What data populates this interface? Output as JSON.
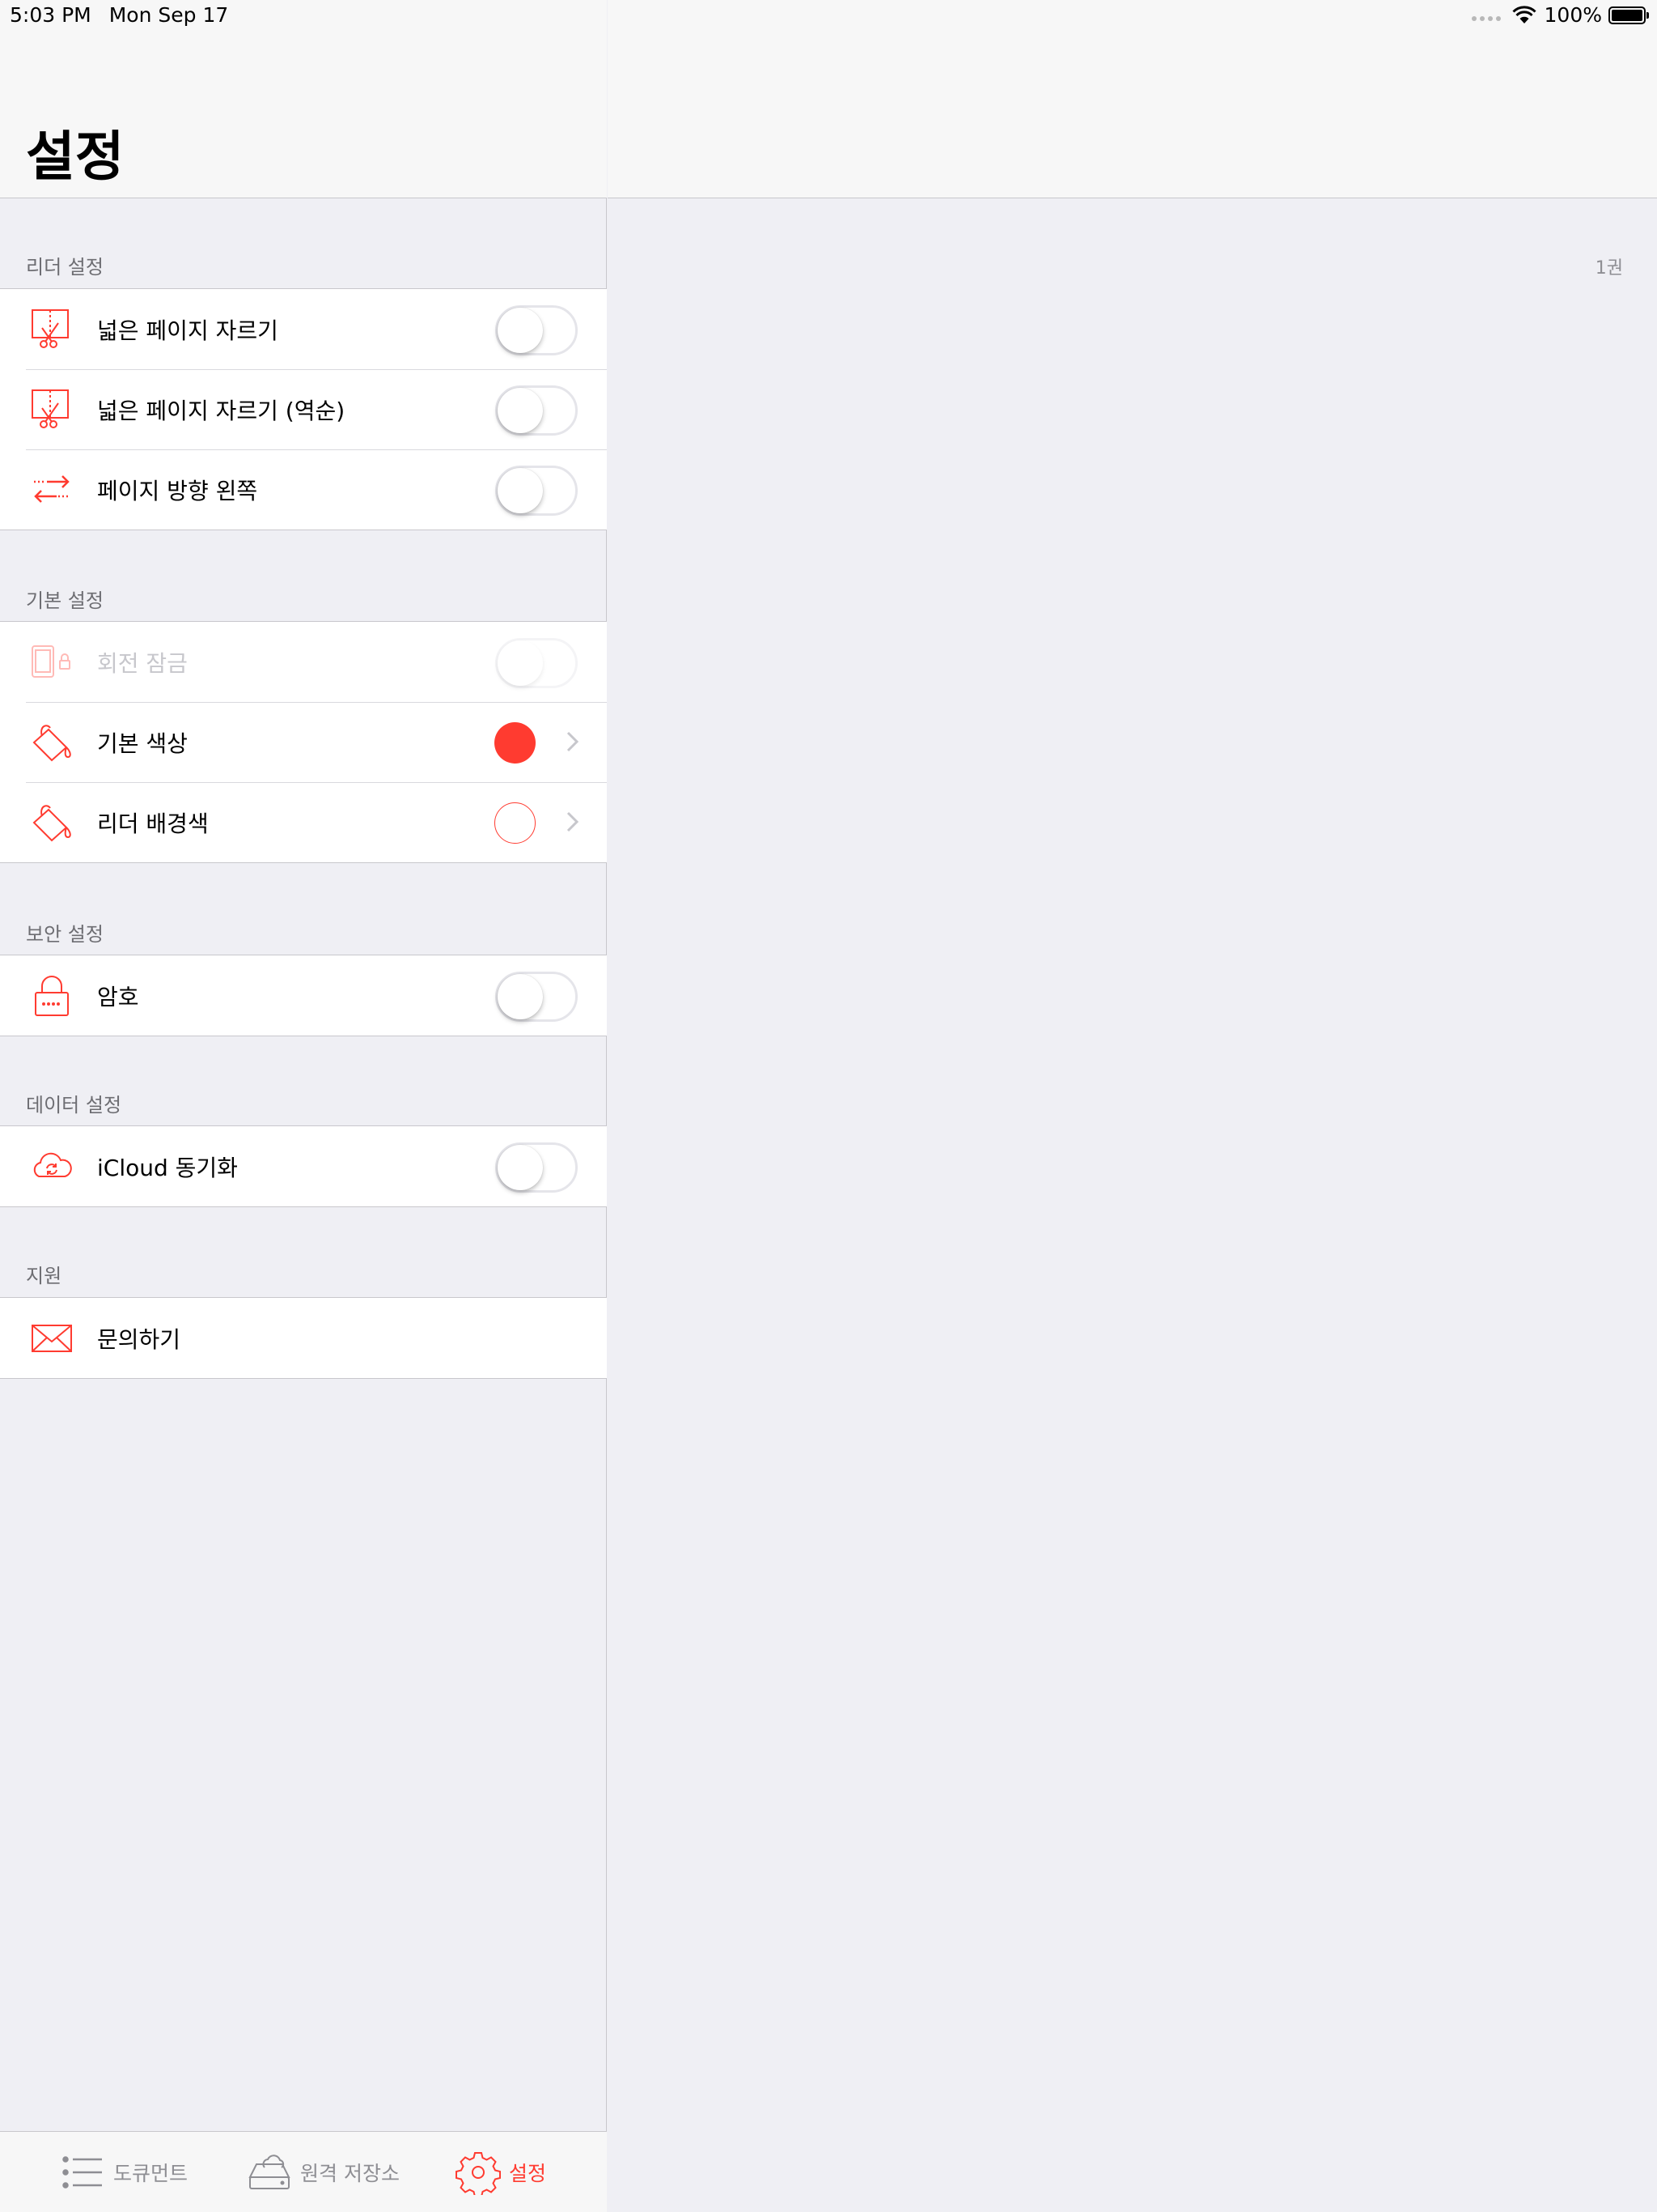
{
  "status_bar": {
    "time": "5:03 PM",
    "date": "Mon Sep 17",
    "battery": "100%"
  },
  "title": "설정",
  "right_pane": {
    "count": "1권"
  },
  "colors": {
    "accent": "#ff3b30"
  },
  "sections": [
    {
      "header": "리더 설정",
      "rows": [
        {
          "label": "넓은 페이지 자르기",
          "icon": "crop-scissors-icon",
          "control": "toggle"
        },
        {
          "label": "넓은 페이지 자르기 (역순)",
          "icon": "crop-scissors-icon",
          "control": "toggle"
        },
        {
          "label": "페이지 방향 왼쪽",
          "icon": "swap-arrows-icon",
          "control": "toggle"
        }
      ]
    },
    {
      "header": "기본 설정",
      "rows": [
        {
          "label": "회전 잠금",
          "icon": "rotation-lock-icon",
          "control": "toggle",
          "disabled": true
        },
        {
          "label": "기본 색상",
          "icon": "paint-bucket-icon",
          "control": "color",
          "color": "#ff3b30"
        },
        {
          "label": "리더 배경색",
          "icon": "paint-bucket-icon",
          "control": "color",
          "color": "#ffffff"
        }
      ]
    },
    {
      "header": "보안 설정",
      "rows": [
        {
          "label": "암호",
          "icon": "lock-icon",
          "control": "toggle"
        }
      ]
    },
    {
      "header": "데이터 설정",
      "rows": [
        {
          "label": "iCloud 동기화",
          "icon": "cloud-sync-icon",
          "control": "toggle"
        }
      ]
    },
    {
      "header": "지원",
      "rows": [
        {
          "label": "문의하기",
          "icon": "mail-icon",
          "control": "none"
        }
      ]
    }
  ],
  "tabs": [
    {
      "label": "도큐먼트",
      "icon": "list-icon",
      "active": false
    },
    {
      "label": "원격 저장소",
      "icon": "cloud-drive-icon",
      "active": false
    },
    {
      "label": "설정",
      "icon": "gear-icon",
      "active": true
    }
  ]
}
